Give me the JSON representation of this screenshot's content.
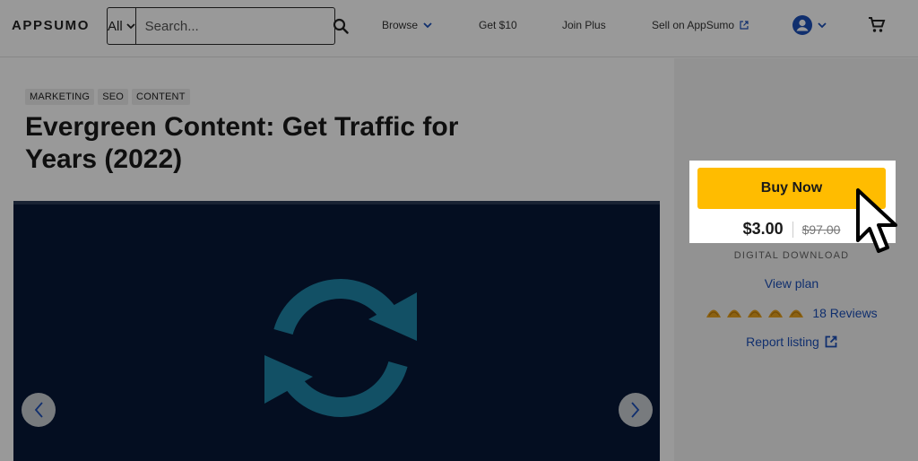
{
  "header": {
    "logo": "APPSUMO",
    "search": {
      "category": "All",
      "placeholder": "Search..."
    },
    "nav": {
      "browse": "Browse",
      "get10": "Get $10",
      "join_plus": "Join Plus",
      "sell": "Sell on AppSumo"
    }
  },
  "product": {
    "tags": [
      "MARKETING",
      "SEO",
      "CONTENT"
    ],
    "title": "Evergreen Content: Get Traffic for Years (2022)",
    "buy_label": "Buy Now",
    "price": "$3.00",
    "original_price": "$97.00",
    "delivery": "DIGITAL DOWNLOAD",
    "view_plan": "View plan",
    "rating": {
      "stars": 5,
      "reviews": "18 Reviews"
    },
    "report": "Report listing"
  },
  "colors": {
    "accent": "#ffbc00",
    "link": "#1c4fb8",
    "media_bg": "#071838",
    "refresh_icon": "#1e86a8",
    "taco": "#e8a21f"
  }
}
